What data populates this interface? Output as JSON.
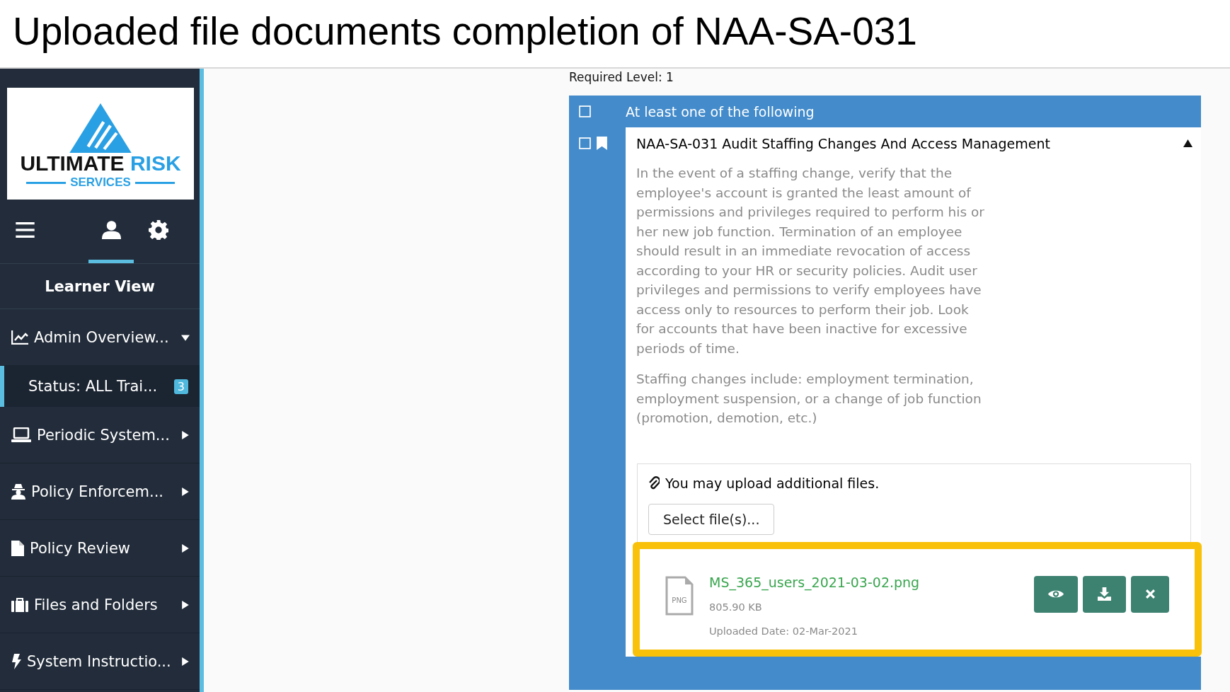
{
  "slide_title": "Uploaded file documents completion of NAA-SA-031",
  "logo": {
    "word1": "ULTIMATE",
    "word2": "RISK",
    "subtitle": "SERVICES"
  },
  "sidebar": {
    "tabs": [
      {
        "kind": "menu",
        "selected": false
      },
      {
        "kind": "user",
        "selected": true
      },
      {
        "kind": "settings",
        "selected": false
      }
    ],
    "view_label": "Learner View",
    "items": [
      {
        "kind": "chart",
        "label": "Admin Overview...",
        "expanded": true,
        "children": [
          {
            "label": "Status: ALL Trai...",
            "badge": "3",
            "selected": true
          }
        ]
      },
      {
        "kind": "laptop",
        "label": "Periodic System...",
        "expanded": false
      },
      {
        "kind": "agent",
        "label": "Policy Enforcem...",
        "expanded": false
      },
      {
        "kind": "file",
        "label": "Policy Review",
        "expanded": false
      },
      {
        "kind": "briefcase",
        "label": "Files and Folders",
        "expanded": false
      },
      {
        "kind": "bolt",
        "label": "System Instructio...",
        "expanded": false
      }
    ]
  },
  "main": {
    "required_level": "Required Level: 1",
    "group": {
      "label": "At least one of the following",
      "checked": false
    },
    "requirement": {
      "title": "NAA-SA-031 Audit Staffing Changes And Access Management",
      "checked": false,
      "bookmarked": true,
      "expanded": true,
      "paragraphs": [
        "In the event of a staffing change, verify that the employee's account is granted the least amount of permissions and privileges required to perform his or her new job function. Termination of an employee should result in an immediate revocation of access according to your HR or security policies. Audit user privileges and permissions to verify employees have access only to resources to perform their job. Look for accounts that have been inactive for excessive periods of time.",
        "Staffing changes include: employment termination, employment suspension, or a change of job function (promotion, demotion, etc.)"
      ],
      "upload": {
        "note": "You may upload additional files.",
        "button": "Select file(s)...",
        "files": [
          {
            "type_label": "PNG",
            "name": "MS_365_users_2021-03-02.png",
            "size": "805.90 KB",
            "uploaded": "Uploaded Date: 02-Mar-2021",
            "highlighted": true
          }
        ]
      }
    }
  }
}
